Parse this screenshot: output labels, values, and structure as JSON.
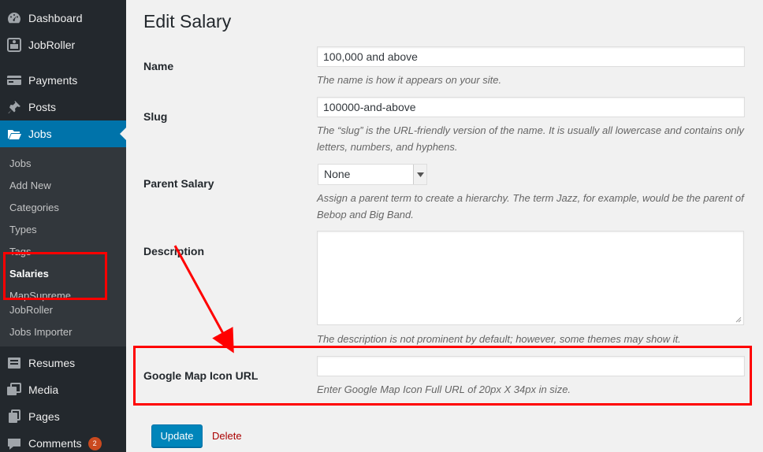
{
  "sidebar": {
    "menu": [
      {
        "label": "Dashboard",
        "icon": "dashboard-icon"
      },
      {
        "label": "JobRoller",
        "icon": "jobroller-icon"
      },
      {
        "label": "Payments",
        "icon": "payments-icon"
      },
      {
        "label": "Posts",
        "icon": "pin-icon"
      },
      {
        "label": "Jobs",
        "icon": "folder-icon",
        "current": true
      },
      {
        "label": "Resumes",
        "icon": "resumes-icon"
      },
      {
        "label": "Media",
        "icon": "media-icon"
      },
      {
        "label": "Pages",
        "icon": "pages-icon"
      },
      {
        "label": "Comments",
        "icon": "comments-icon",
        "badge": "2"
      }
    ],
    "submenu": [
      "Jobs",
      "Add New",
      "Categories",
      "Types",
      "Tags",
      "Salaries",
      "MapSupreme",
      "JobRoller",
      "Jobs Importer"
    ],
    "current_submenu": "Salaries"
  },
  "page": {
    "title": "Edit Salary"
  },
  "form": {
    "name": {
      "label": "Name",
      "value": "100,000 and above",
      "description": "The name is how it appears on your site."
    },
    "slug": {
      "label": "Slug",
      "value": "100000-and-above",
      "description": "The “slug” is the URL-friendly version of the name. It is usually all lowercase and contains only letters, numbers, and hyphens."
    },
    "parent": {
      "label": "Parent Salary",
      "selected": "None",
      "description": "Assign a parent term to create a hierarchy. The term Jazz, for example, would be the parent of Bebop and Big Band."
    },
    "description": {
      "label": "Description",
      "value": "",
      "description": "The description is not prominent by default; however, some themes may show it."
    },
    "map_icon": {
      "label": "Google Map Icon URL",
      "value": "",
      "description": "Enter Google Map Icon Full URL of 20px X 34px in size."
    }
  },
  "actions": {
    "update": "Update",
    "delete": "Delete"
  },
  "colors": {
    "sidebar_bg": "#23282d",
    "submenu_bg": "#32373c",
    "accent": "#0073aa",
    "annotation": "#ff0000",
    "delete": "#aa0000"
  }
}
